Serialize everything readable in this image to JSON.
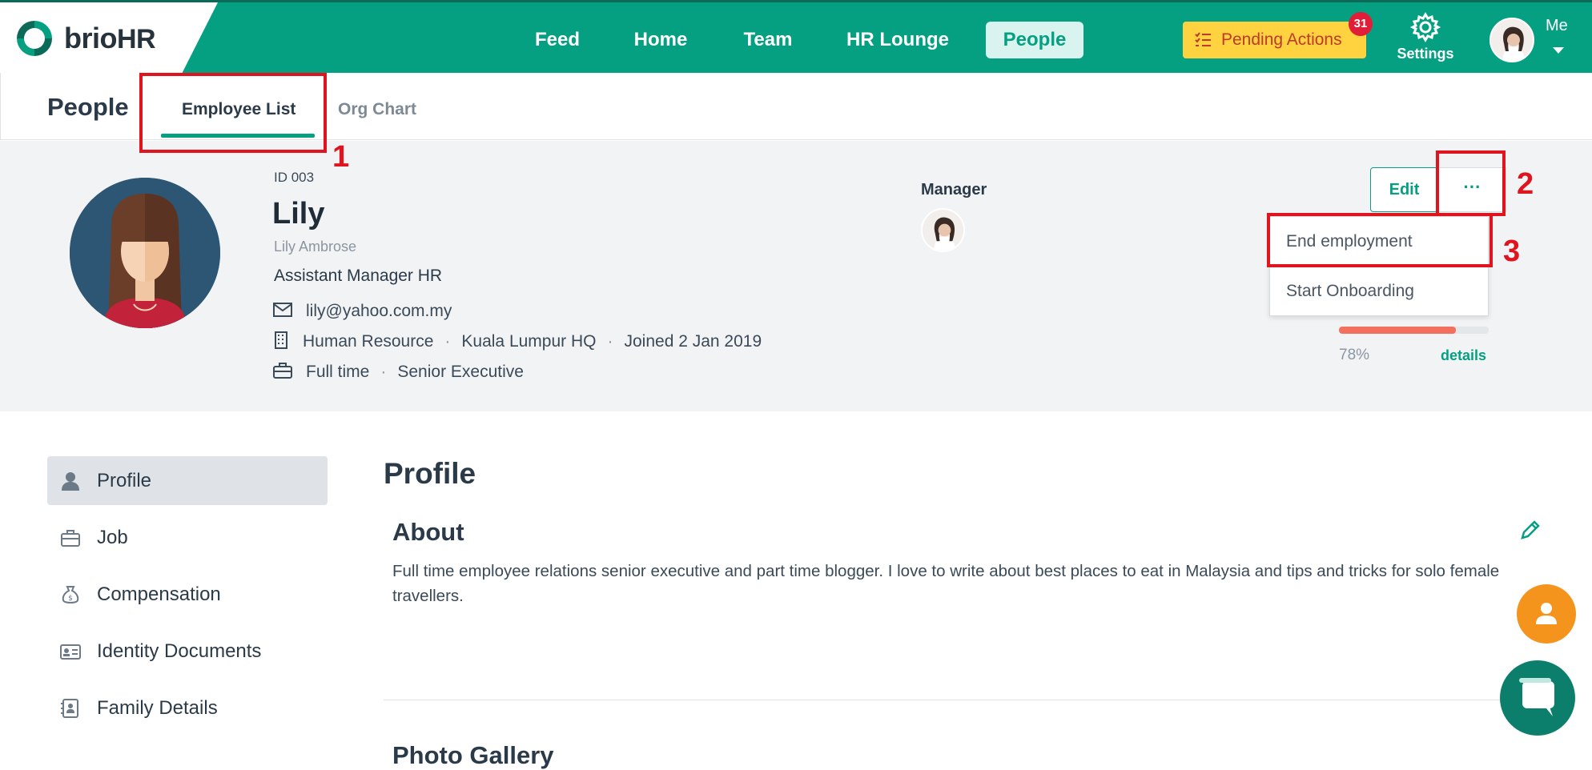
{
  "brand": {
    "logo_main": "brio",
    "logo_suffix": "HR"
  },
  "topnav": {
    "items": [
      {
        "label": "Feed"
      },
      {
        "label": "Home"
      },
      {
        "label": "Team"
      },
      {
        "label": "HR Lounge"
      },
      {
        "label": "People"
      }
    ],
    "active": "People",
    "pending_label": "Pending Actions",
    "pending_count": "31",
    "settings_label": "Settings",
    "me_label": "Me"
  },
  "subnav": {
    "title": "People",
    "tabs": [
      {
        "label": "Employee List"
      },
      {
        "label": "Org Chart"
      }
    ],
    "active": "Employee List"
  },
  "employee": {
    "id": "ID 003",
    "name": "Lily",
    "full_name": "Lily Ambrose",
    "title": "Assistant Manager HR",
    "email": "lily@yahoo.com.my",
    "department": "Human Resource",
    "location": "Kuala Lumpur HQ",
    "joined": "Joined 2 Jan 2019",
    "employment_type": "Full time",
    "level": "Senior Executive",
    "separator": "·",
    "manager_label": "Manager"
  },
  "actions": {
    "edit_label": "Edit",
    "more_label": "···",
    "menu": [
      {
        "label": "End employment"
      },
      {
        "label": "Start Onboarding"
      }
    ]
  },
  "profile_progress": {
    "percent_label": "78%",
    "value": 0.78,
    "details_label": "details"
  },
  "annotations": [
    {
      "label": "1"
    },
    {
      "label": "2"
    },
    {
      "label": "3"
    }
  ],
  "side_menu": {
    "items": [
      {
        "label": "Profile",
        "icon": "person-icon"
      },
      {
        "label": "Job",
        "icon": "briefcase-icon"
      },
      {
        "label": "Compensation",
        "icon": "money-bag-icon"
      },
      {
        "label": "Identity Documents",
        "icon": "id-card-icon"
      },
      {
        "label": "Family Details",
        "icon": "contact-book-icon"
      }
    ],
    "active": "Profile"
  },
  "profile": {
    "title": "Profile",
    "about_title": "About",
    "about_text": "Full time employee relations senior executive and part time blogger. I love to write about best places to eat in Malaysia and tips and tricks for solo female travellers.",
    "next_section_title": "Photo Gallery"
  },
  "colors": {
    "brand_green": "#05a082",
    "pending_yellow": "#ffd23f",
    "badge_red": "#e01e37",
    "annotation_red": "#e0141e",
    "progress_fill": "#f36f5e"
  }
}
